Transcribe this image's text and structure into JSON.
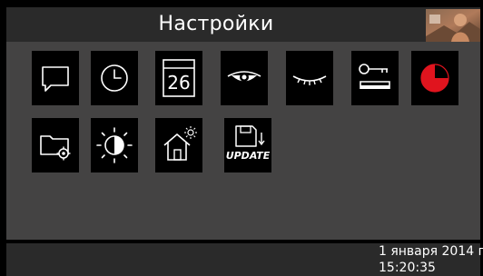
{
  "header": {
    "title": "Настройки"
  },
  "tiles": [
    {
      "name": "messages-icon"
    },
    {
      "name": "clock-icon"
    },
    {
      "name": "calendar-icon",
      "day": "26"
    },
    {
      "name": "eye-open-icon"
    },
    {
      "name": "eye-closed-icon"
    },
    {
      "name": "key-bed-icon"
    },
    {
      "name": "red-pie-icon"
    },
    {
      "name": "folder-gear-icon"
    },
    {
      "name": "brightness-icon"
    },
    {
      "name": "house-sun-icon"
    },
    {
      "name": "update-icon",
      "label": "UPDATE"
    }
  ],
  "footer": {
    "date": "1 января 2014 г.",
    "time": "15:20:35"
  },
  "colors": {
    "header_bg": "#2a2a2a",
    "content_bg": "#444343",
    "tile_bg": "#000000",
    "accent_red": "#e0141e"
  }
}
